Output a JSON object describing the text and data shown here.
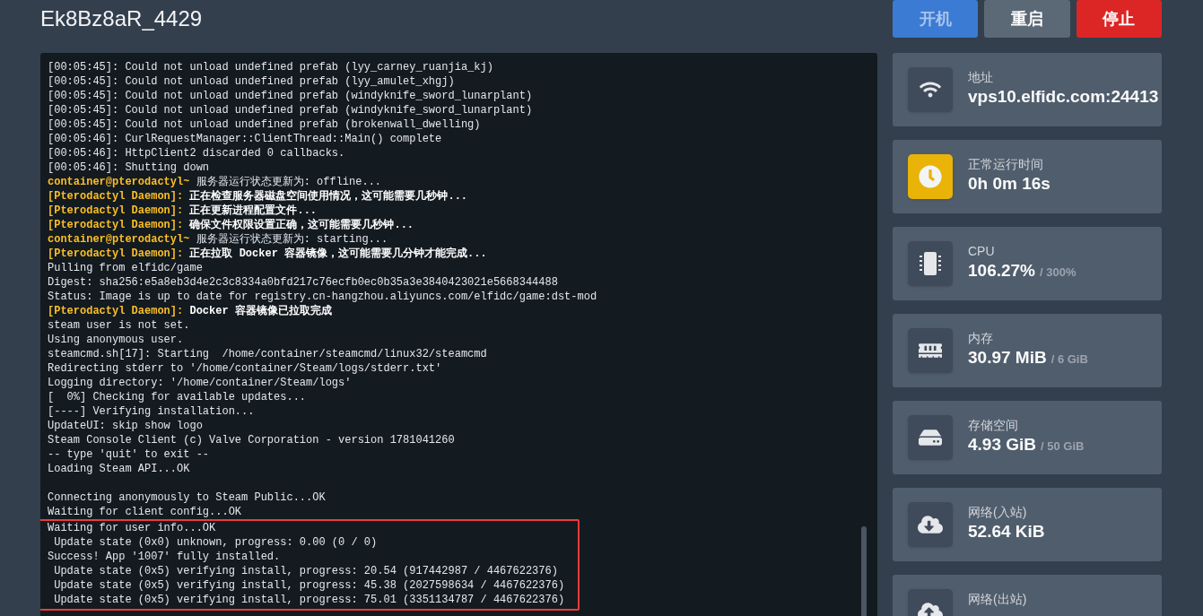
{
  "server": {
    "name": "Ek8Bz8aR_4429"
  },
  "power_buttons": [
    {
      "label": "开机",
      "kind": "start",
      "disabled": true
    },
    {
      "label": "重启",
      "kind": "restart",
      "disabled": false
    },
    {
      "label": "停止",
      "kind": "stop",
      "disabled": false
    }
  ],
  "console": {
    "lines": [
      {
        "kind": "plain",
        "text": "[00:05:45]: Could not unload undefined prefab (lyy_carney_ruanjia_kj)"
      },
      {
        "kind": "plain",
        "text": "[00:05:45]: Could not unload undefined prefab (lyy_amulet_xhgj)"
      },
      {
        "kind": "plain",
        "text": "[00:05:45]: Could not unload undefined prefab (windyknife_sword_lunarplant)"
      },
      {
        "kind": "plain",
        "text": "[00:05:45]: Could not unload undefined prefab (windyknife_sword_lunarplant)"
      },
      {
        "kind": "plain",
        "text": "[00:05:45]: Could not unload undefined prefab (brokenwall_dwelling)"
      },
      {
        "kind": "plain",
        "text": "[00:05:46]: CurlRequestManager::ClientThread::Main() complete"
      },
      {
        "kind": "plain",
        "text": "[00:05:46]: HttpClient2 discarded 0 callbacks."
      },
      {
        "kind": "plain",
        "text": "[00:05:46]: Shutting down"
      },
      {
        "kind": "prompt",
        "prefix": "container@pterodactyl~",
        "text": "服务器运行状态更新为: offline..."
      },
      {
        "kind": "daemon",
        "prefix": "[Pterodactyl Daemon]:",
        "text": "正在检查服务器磁盘空间使用情况，这可能需要几秒钟..."
      },
      {
        "kind": "daemon",
        "prefix": "[Pterodactyl Daemon]:",
        "text": "正在更新进程配置文件..."
      },
      {
        "kind": "daemon",
        "prefix": "[Pterodactyl Daemon]:",
        "text": "确保文件权限设置正确，这可能需要几秒钟..."
      },
      {
        "kind": "prompt",
        "prefix": "container@pterodactyl~",
        "text": "服务器运行状态更新为: starting..."
      },
      {
        "kind": "daemon",
        "prefix": "[Pterodactyl Daemon]:",
        "text": "正在拉取 Docker 容器镜像，这可能需要几分钟才能完成..."
      },
      {
        "kind": "plain",
        "text": "Pulling from elfidc/game"
      },
      {
        "kind": "plain",
        "text": "Digest: sha256:e5a8eb3d4e2c3c8334a0bfd217c76ecfb0ec0b35a3e3840423021e5668344488"
      },
      {
        "kind": "plain",
        "text": "Status: Image is up to date for registry.cn-hangzhou.aliyuncs.com/elfidc/game:dst-mod"
      },
      {
        "kind": "daemon",
        "prefix": "[Pterodactyl Daemon]:",
        "text": "Docker 容器镜像已拉取完成"
      },
      {
        "kind": "plain",
        "text": "steam user is not set."
      },
      {
        "kind": "plain",
        "text": "Using anonymous user."
      },
      {
        "kind": "plain",
        "text": "steamcmd.sh[17]: Starting  /home/container/steamcmd/linux32/steamcmd"
      },
      {
        "kind": "plain",
        "text": "Redirecting stderr to '/home/container/Steam/logs/stderr.txt'"
      },
      {
        "kind": "plain",
        "text": "Logging directory: '/home/container/Steam/logs'"
      },
      {
        "kind": "plain",
        "text": "[  0%] Checking for available updates..."
      },
      {
        "kind": "plain",
        "text": "[----] Verifying installation..."
      },
      {
        "kind": "plain",
        "text": "UpdateUI: skip show logo"
      },
      {
        "kind": "plain",
        "text": "Steam Console Client (c) Valve Corporation - version 1781041260"
      },
      {
        "kind": "plain",
        "text": "-- type 'quit' to exit --"
      },
      {
        "kind": "plain",
        "text": "Loading Steam API...OK"
      },
      {
        "kind": "blank"
      },
      {
        "kind": "plain",
        "text": "Connecting anonymously to Steam Public...OK"
      },
      {
        "kind": "plain",
        "text": "Waiting for client config...OK"
      }
    ],
    "highlighted_lines": [
      {
        "kind": "plain",
        "text": "Waiting for user info...OK"
      },
      {
        "kind": "plain",
        "text": " Update state (0x0) unknown, progress: 0.00 (0 / 0)"
      },
      {
        "kind": "plain",
        "text": "Success! App '1007' fully installed."
      },
      {
        "kind": "plain",
        "text": " Update state (0x5) verifying install, progress: 20.54 (917442987 / 4467622376)"
      },
      {
        "kind": "plain",
        "text": " Update state (0x5) verifying install, progress: 45.38 (2027598634 / 4467622376)"
      },
      {
        "kind": "plain",
        "text": " Update state (0x5) verifying install, progress: 75.01 (3351134787 / 4467622376)"
      }
    ]
  },
  "stats": [
    {
      "kind": "address",
      "label": "地址",
      "value": "vps10.elfidc.com:24413",
      "color": "#3f4a5a"
    },
    {
      "kind": "uptime",
      "label": "正常运行时间",
      "value": "0h 0m 16s",
      "color": "#eab308"
    },
    {
      "kind": "cpu",
      "label": "CPU",
      "value": "106.27%",
      "limit": "/ 300%",
      "color": "#3f4a5a"
    },
    {
      "kind": "memory",
      "label": "内存",
      "value": "30.97 MiB",
      "limit": "/ 6 GiB",
      "color": "#3f4a5a"
    },
    {
      "kind": "disk",
      "label": "存储空间",
      "value": "4.93 GiB",
      "limit": "/ 50 GiB",
      "color": "#3f4a5a"
    },
    {
      "kind": "net_in",
      "label": "网络(入站)",
      "value": "52.64 KiB",
      "color": "#3f4a5a"
    },
    {
      "kind": "net_out",
      "label": "网络(出站)",
      "color": "#3f4a5a"
    }
  ]
}
